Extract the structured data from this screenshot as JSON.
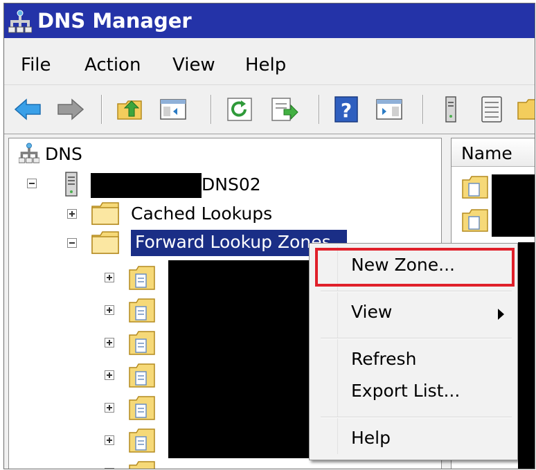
{
  "window": {
    "title": "DNS Manager"
  },
  "menubar": {
    "items": [
      "File",
      "Action",
      "View",
      "Help"
    ]
  },
  "toolbar": {
    "buttons": [
      "back-icon",
      "forward-icon",
      "up-folder-icon",
      "show-hide-tree-icon",
      "refresh-icon",
      "export-list-icon",
      "help-icon",
      "action-pane-icon",
      "server-icon",
      "zone-list-icon",
      "folder-icon"
    ]
  },
  "tree": {
    "root_label": "DNS",
    "server_suffix": "DNS02",
    "nodes": {
      "cached": "Cached Lookups",
      "forward": "Forward Lookup Zones"
    },
    "zone_count": 7
  },
  "list": {
    "column_name": "Name"
  },
  "context_menu": {
    "new_zone": "New Zone...",
    "view": "View",
    "refresh": "Refresh",
    "export_list": "Export List...",
    "help": "Help"
  },
  "colors": {
    "title_bar": "#2433a8",
    "selection": "#1a2e86",
    "highlight_box": "#e0202a"
  }
}
